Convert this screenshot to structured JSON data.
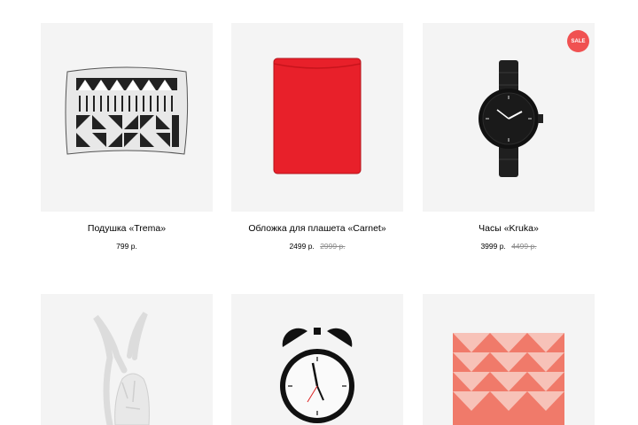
{
  "accent_colors": {
    "sale": "#f05151",
    "card_background": "#f4f4f4",
    "old_price": "#8c8c8c"
  },
  "products": [
    {
      "title": "Подушка «Trema»",
      "price": "799 р.",
      "old_price": "",
      "badge": "",
      "icon": "pillow-pattern-image"
    },
    {
      "title": "Обложка для плашета «Carnet»",
      "price": "2499 р.",
      "old_price": "2999 р.",
      "badge": "",
      "icon": "red-tablet-sleeve-image"
    },
    {
      "title": "Часы «Kruka»",
      "price": "3999 р.",
      "old_price": "4499 р.",
      "badge": "SALE",
      "icon": "black-wristwatch-image"
    },
    {
      "icon": "white-antelope-figurine-image"
    },
    {
      "icon": "alarm-clock-image"
    },
    {
      "icon": "red-triangle-pillow-image"
    }
  ]
}
